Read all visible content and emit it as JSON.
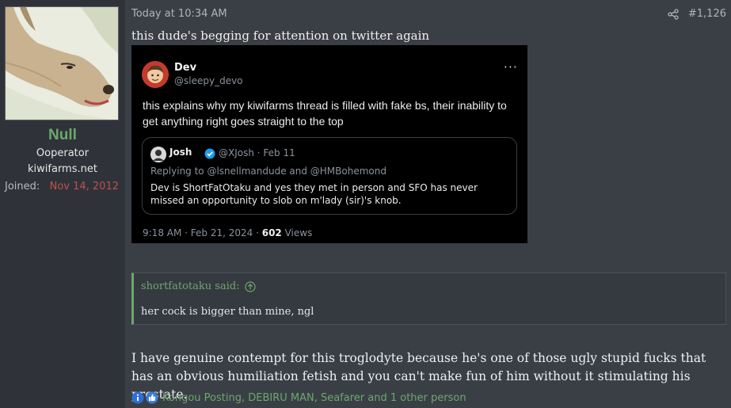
{
  "user": {
    "name": "Null",
    "title": "Ooperator",
    "site": "kiwifarms.net",
    "joined_label": "Joined:",
    "joined_date": "Nov 14, 2012"
  },
  "post": {
    "date": "Today at 10:34 AM",
    "number": "#1,126",
    "first_line": "this dude's begging for attention on twitter again",
    "body": "I have genuine contempt for this troglodyte because he's one of those ugly stupid fucks that has an obvious humiliation fetish and you can't make fun of him without it stimulating his prostate.",
    "reactions_text": "Kongou Posting, DEBIRU MAN, Seafarer and 1 other person"
  },
  "tweet": {
    "name": "Dev",
    "handle": "@sleepy_devo",
    "more": "···",
    "text": "this explains why my kiwifarms thread is filled with fake bs, their inability to get anything right goes straight to the top",
    "quote": {
      "name": "Josh",
      "meta": "@XJosh · Feb 11",
      "reply": "Replying to @lsnellmandude and @HMBohemond",
      "text": "Dev is ShortFatOtaku and yes they met in person and SFO has never missed an opportunity to slob on m'lady (sir)'s knob."
    },
    "footer_time": "9:18 AM · Feb 21, 2024 · ",
    "views_count": "602",
    "views_label": " Views"
  },
  "quote_block": {
    "attribution": "shortfatotaku said:",
    "text": "her cock is bigger than mine, ngl"
  },
  "colors": {
    "accent_green": "#6ca86c",
    "join_date_red": "#c0504d",
    "twitter_verified": "#1d9bf0"
  },
  "icons": [
    "share-icon",
    "quote-up-arrow-icon",
    "info-reaction-icon",
    "like-reaction-icon",
    "verified-badge-icon",
    "more-options-icon"
  ]
}
